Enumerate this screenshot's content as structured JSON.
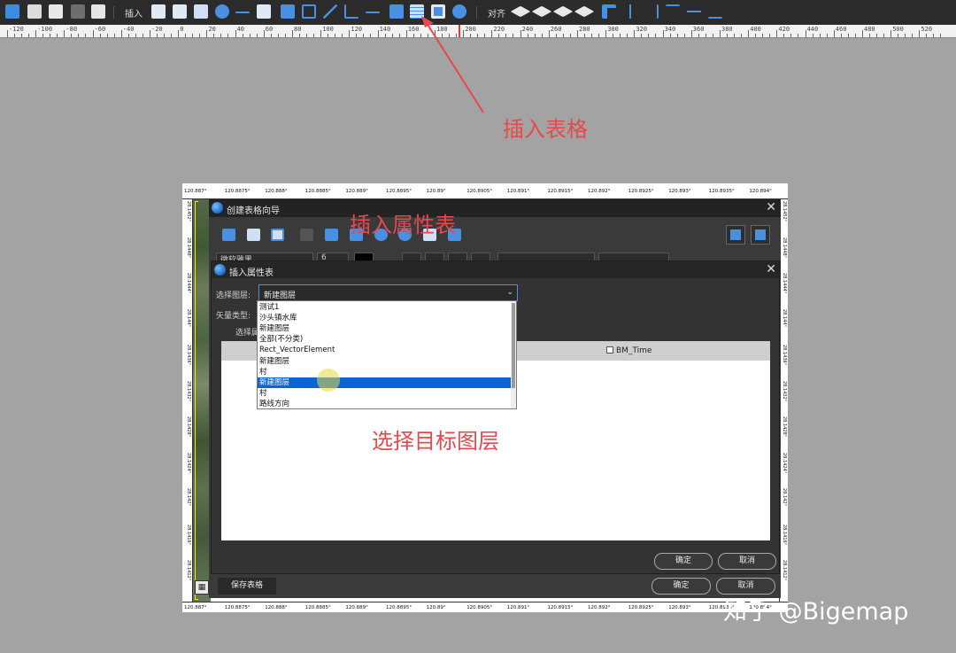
{
  "toolbar": {
    "insert_label": "插入",
    "align_label": "对齐",
    "colors": {
      "bg": "#2b2b2b",
      "icon_blue": "#4a90e2",
      "icon_white": "#e8e8e8"
    }
  },
  "ruler": {
    "ticks": [
      "-120",
      "-100",
      "-80",
      "-60",
      "-40",
      "-20",
      "0",
      "20",
      "40",
      "60",
      "80",
      "100",
      "120",
      "140",
      "160",
      "180",
      "200",
      "220",
      "240",
      "260",
      "280",
      "300",
      "320",
      "340",
      "360",
      "380",
      "400",
      "420",
      "440",
      "460",
      "480",
      "500",
      "520"
    ]
  },
  "annotations": {
    "insert_table": "插入表格",
    "insert_attr_table": "插入属性表",
    "select_target_layer": "选择目标图层",
    "color": "#e8474b"
  },
  "canvas": {
    "lon_top": [
      "120.887°",
      "120.8875°",
      "120.888°",
      "120.8885°",
      "120.889°",
      "120.8895°",
      "120.89°",
      "120.8905°",
      "120.891°",
      "120.8915°",
      "120.892°",
      "120.8925°",
      "120.893°",
      "120.8935°",
      "120.894°"
    ],
    "lon_bottom": [
      "120.887°",
      "120.8875°",
      "120.888°",
      "120.8885°",
      "120.889°",
      "120.8895°",
      "120.89°",
      "120.8905°",
      "120.891°",
      "120.8915°",
      "120.892°",
      "120.8925°",
      "120.893°",
      "120.8935°",
      "120.894°"
    ],
    "lat_left": [
      "28.1452°",
      "28.1448°",
      "28.1444°",
      "28.144°",
      "28.1436°",
      "28.1432°",
      "28.1428°",
      "28.1424°",
      "28.142°",
      "28.1416°",
      "28.1412°"
    ],
    "lat_right": [
      "28.1452°",
      "28.1448°",
      "28.1444°",
      "28.144°",
      "28.1436°",
      "28.1432°",
      "28.1428°",
      "28.1424°",
      "28.142°",
      "28.1416°",
      "28.1412°"
    ]
  },
  "outer_dialog": {
    "title": "创建表格向导",
    "font_value": "微软雅黑",
    "font_size_value": "6",
    "save_table_label": "保存表格",
    "ok_label": "确定",
    "cancel_label": "取消"
  },
  "inner_dialog": {
    "title": "插入属性表",
    "layer_label": "选择图层:",
    "layer_value": "新建图层",
    "vector_type_label": "矢量类型:",
    "select_attr_label": "选择属",
    "field_bm_time": "BM_Time",
    "ok_label": "确定",
    "cancel_label": "取消"
  },
  "layer_dropdown": {
    "items": [
      "测试1",
      "沙头镇水库",
      "新建图层",
      "全部(不分类)",
      "Rect_VectorElement",
      "新建图层",
      "村",
      "新建图层",
      "村",
      "路线方向"
    ],
    "selected_index": 7,
    "selected_color": "#0a64d6"
  },
  "watermark": "知乎 @Bigemap"
}
